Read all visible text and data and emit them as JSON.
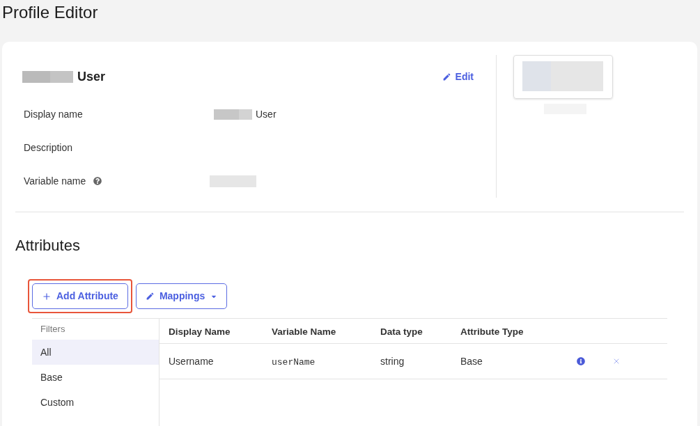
{
  "page_title": "Profile Editor",
  "profile": {
    "name": "User",
    "name_redacted": true,
    "edit_link": "Edit",
    "fields": [
      {
        "label": "Display name",
        "help": false,
        "value_redacted": true,
        "value": "User"
      },
      {
        "label": "Description",
        "help": false,
        "value_redacted": false
      },
      {
        "label": "Variable name",
        "help": true,
        "value_redacted": true
      }
    ]
  },
  "attributes": {
    "title": "Attributes",
    "buttons": [
      {
        "kind": "add",
        "label": "Add Attribute",
        "highlighted": true
      },
      {
        "kind": "mappings",
        "label": "Mappings",
        "highlighted": false
      }
    ],
    "filters": {
      "title": "Filters",
      "items": [
        {
          "label": "All",
          "selected": true
        },
        {
          "label": "Base",
          "selected": false
        },
        {
          "label": "Custom",
          "selected": false
        }
      ]
    },
    "table": {
      "columns": [
        "Display Name",
        "Variable Name",
        "Data type",
        "Attribute Type"
      ],
      "rows": [
        {
          "display_name": "Username",
          "variable_name": "userName",
          "data_type": "string",
          "attribute_type": "Base"
        }
      ]
    }
  }
}
